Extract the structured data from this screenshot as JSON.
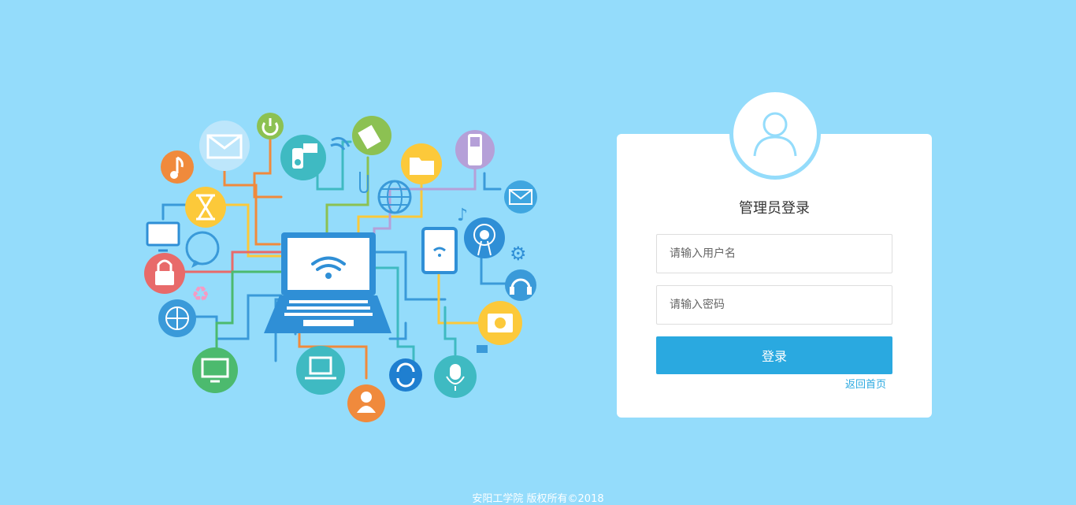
{
  "login": {
    "title": "管理员登录",
    "username_placeholder": "请输入用户名",
    "password_placeholder": "请输入密码",
    "submit_label": "登录",
    "back_home_label": "返回首页"
  },
  "footer": {
    "copyright": "安阳工学院 版权所有©2018"
  },
  "colors": {
    "background": "#94dcfb",
    "primary": "#2aa9e0",
    "card": "#ffffff"
  },
  "illustration": {
    "icons": [
      "laptop-icon",
      "wifi-icon",
      "envelope-icon",
      "music-note-icon",
      "power-icon",
      "video-camera-icon",
      "document-icon",
      "folder-icon",
      "mobile-phone-icon",
      "globe-icon",
      "hourglass-icon",
      "lock-icon",
      "monitor-icon",
      "chat-icon",
      "recycle-icon",
      "tablet-icon",
      "antenna-icon",
      "gear-icon",
      "headphones-icon",
      "camera-icon",
      "sync-icon",
      "microphone-icon",
      "user-icon",
      "paperclip-icon"
    ]
  }
}
